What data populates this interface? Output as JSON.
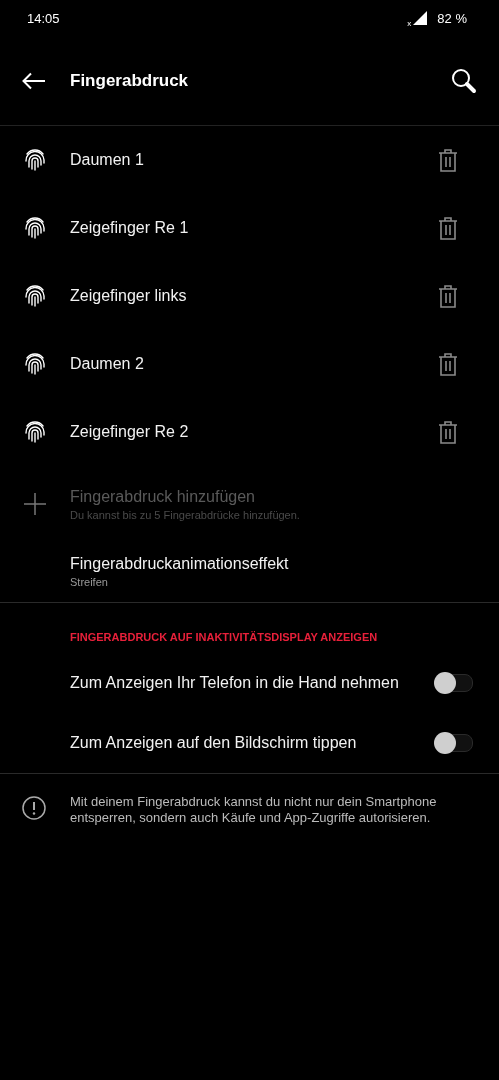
{
  "status_bar": {
    "time": "14:05",
    "signal_badge": "x",
    "battery": "82 %"
  },
  "toolbar": {
    "title": "Fingerabdruck"
  },
  "fingerprints": [
    {
      "name": "Daumen 1"
    },
    {
      "name": "Zeigefinger Re 1"
    },
    {
      "name": "Zeigefinger links"
    },
    {
      "name": "Daumen 2"
    },
    {
      "name": "Zeigefinger Re 2"
    }
  ],
  "add_fingerprint": {
    "title": "Fingerabdruck hinzufügen",
    "subtitle": "Du kannst bis zu 5 Fingerabdrücke hinzufügen.",
    "disabled": true
  },
  "animation_effect": {
    "title": "Fingerabdruckanimationseffekt",
    "value": "Streifen"
  },
  "ambient_section": {
    "header": "FINGERABDRUCK AUF INAKTIVITÄTSDISPLAY ANZEIGEN",
    "toggles": [
      {
        "label": "Zum Anzeigen Ihr Telefon in die Hand nehmen",
        "on": false
      },
      {
        "label": "Zum Anzeigen auf den Bildschirm tippen",
        "on": false
      }
    ]
  },
  "info": {
    "text": "Mit deinem Fingerabdruck kannst du nicht nur dein Smartphone entsperren, sondern auch Käufe und App-Zugriffe autorisieren."
  }
}
